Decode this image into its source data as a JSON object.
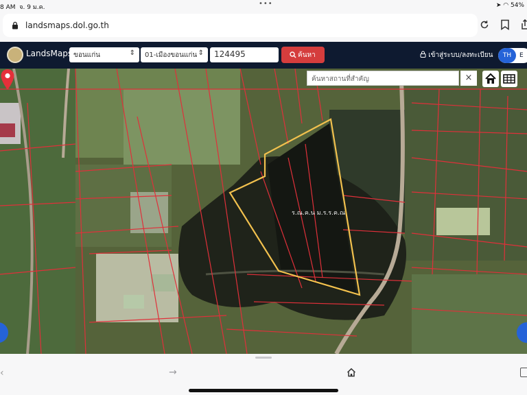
{
  "status_bar": {
    "time_fragment": "8 AM",
    "date": "จ. 9 ม.ค.",
    "battery": "54%"
  },
  "browser": {
    "url": "landsmaps.dol.go.th"
  },
  "app": {
    "name": "LandsMaps",
    "province_select": "ขอนแก่น",
    "district_select": "01-เมืองขอนแก่น",
    "parcel_number_input": "124495",
    "search_button": "ค้นหา",
    "login_link": "เข้าสู่ระบบ/ลงทะเบียน",
    "lang_th": "TH",
    "lang_en": "E"
  },
  "map": {
    "place_search_placeholder": "ค้นหาสถานที่สำคัญ",
    "clear_button": "×",
    "parcel_label": "ร.ณ.ค.น ม.ร.ร.ค.ณ",
    "parcel_outline_color": "#f2c14e",
    "boundary_color": "#e0303a",
    "marker_color": "#e5303a"
  },
  "icons": {
    "lock": "lock-icon",
    "reload": "reload-icon",
    "bookmark": "bookmark-icon",
    "share": "share-icon",
    "home": "home-icon",
    "grid": "grid-icon",
    "marker": "map-pin-icon",
    "forward": "forward-arrow-icon"
  },
  "nav": {
    "forward_glyph": "→",
    "back_glyph": "‹"
  }
}
